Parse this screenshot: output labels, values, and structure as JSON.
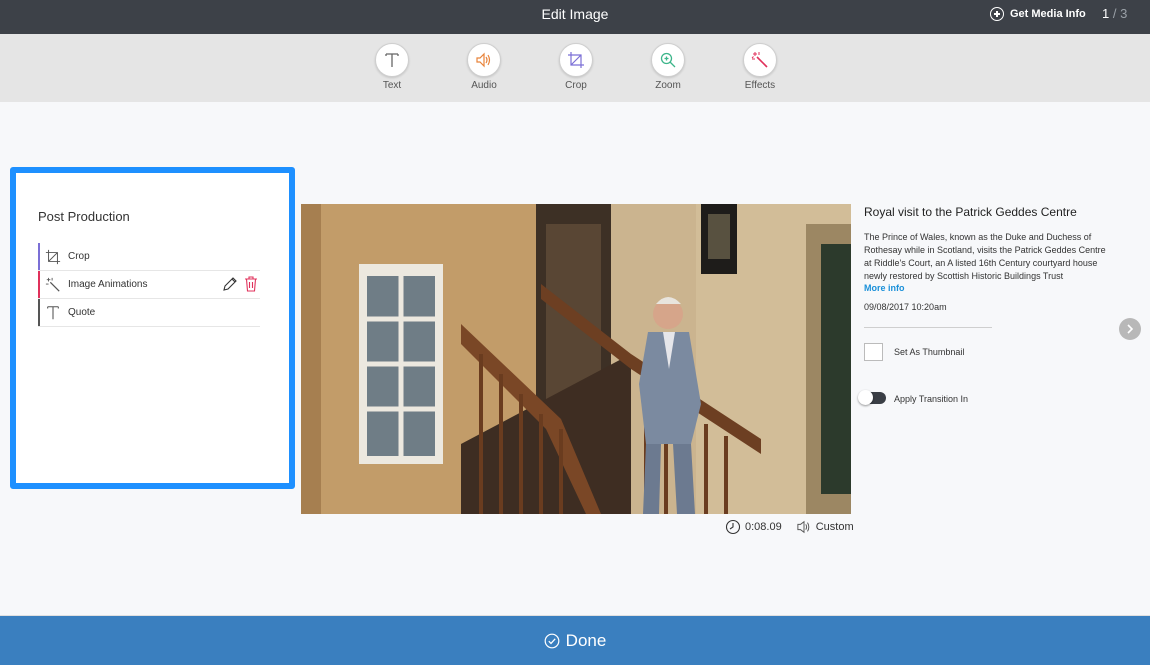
{
  "header": {
    "title": "Edit Image",
    "media_info_label": "Get Media Info",
    "pager_current": "1",
    "pager_sep": "/",
    "pager_total": "3"
  },
  "toolbar": {
    "tools": [
      {
        "label": "Text",
        "icon": "text-icon",
        "color": "#666666"
      },
      {
        "label": "Audio",
        "icon": "audio-icon",
        "color": "#e8833a"
      },
      {
        "label": "Crop",
        "icon": "crop-icon",
        "color": "#7b6fd6"
      },
      {
        "label": "Zoom",
        "icon": "zoom-icon",
        "color": "#3cb58a"
      },
      {
        "label": "Effects",
        "icon": "effects-icon",
        "color": "#e0315b"
      }
    ]
  },
  "panel": {
    "title": "Post Production",
    "items": [
      {
        "label": "Crop",
        "icon": "crop-icon",
        "bar_color": "#7b6fd6"
      },
      {
        "label": "Image Animations",
        "icon": "magic-wand-icon",
        "bar_color": "#e0315b"
      },
      {
        "label": "Quote",
        "icon": "text-icon",
        "bar_color": "#555555"
      }
    ]
  },
  "media": {
    "duration": "0:08.09",
    "audio_label": "Custom"
  },
  "info": {
    "title": "Royal visit to the Patrick Geddes Centre",
    "description": "The Prince of Wales, known as the Duke and Duchess of Rothesay while in Scotland, visits the Patrick Geddes Centre at Riddle's Court, an A listed 16th Century courtyard house newly restored by Scottish Historic Buildings Trust",
    "more_label": "More info",
    "date": "09/08/2017 10:20am",
    "thumbnail_label": "Set As Thumbnail",
    "transition_label": "Apply Transition In"
  },
  "footer": {
    "done_label": "Done"
  },
  "colors": {
    "accent_blue": "#1e90ff",
    "footer_blue": "#3a7fbf",
    "link_blue": "#1a90d9"
  }
}
